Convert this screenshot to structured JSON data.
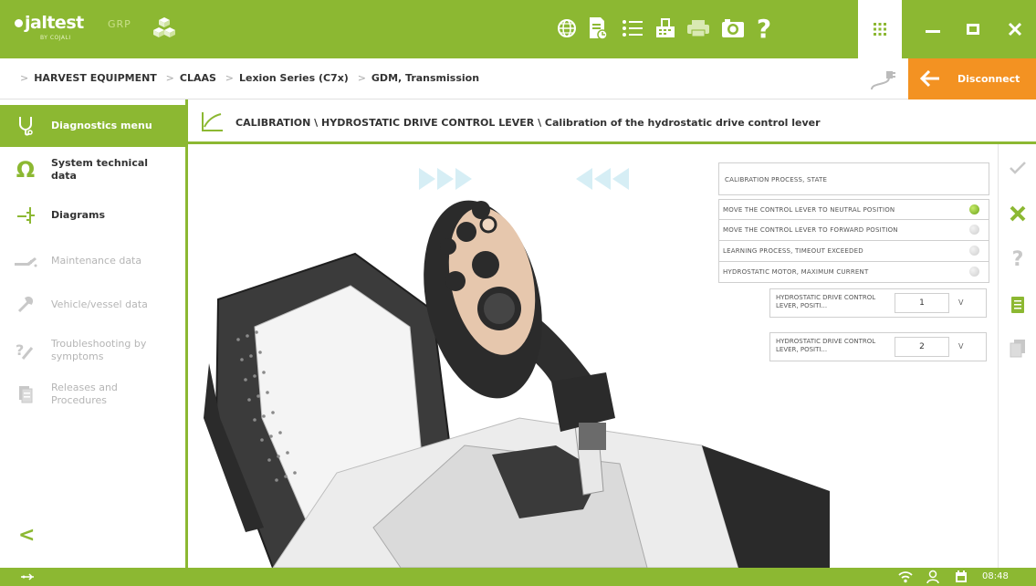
{
  "app": {
    "logo_text": "jaltest",
    "logo_sub": "BY COJALI",
    "logo_grp": "GRP"
  },
  "toolbar": {
    "icons": [
      "globe-icon",
      "report-icon",
      "list-icon",
      "inspection-icon",
      "print-icon",
      "camera-icon",
      "help-icon",
      "apps-grid-icon"
    ],
    "window": [
      "minimize-icon",
      "maximize-icon",
      "close-icon"
    ]
  },
  "breadcrumb": {
    "items": [
      "HARVEST EQUIPMENT",
      "CLAAS",
      "Lexion Series (C7x)",
      "GDM, Transmission"
    ]
  },
  "disconnect": {
    "label": "Disconnect"
  },
  "sidebar": {
    "items": [
      {
        "label": "Diagnostics menu",
        "state": "active"
      },
      {
        "label": "System technical data",
        "state": "enabled"
      },
      {
        "label": "Diagrams",
        "state": "enabled"
      },
      {
        "label": "Maintenance data",
        "state": "disabled"
      },
      {
        "label": "Vehicle/vessel data",
        "state": "disabled"
      },
      {
        "label": "Troubleshooting by symptoms",
        "state": "disabled"
      },
      {
        "label": "Releases and Procedures",
        "state": "disabled"
      }
    ]
  },
  "content": {
    "title": "CALIBRATION \\ HYDROSTATIC DRIVE CONTROL LEVER \\ Calibration of the hydrostatic drive control lever"
  },
  "calibration": {
    "header": "CALIBRATION PROCESS, STATE",
    "steps": [
      {
        "label": "MOVE THE CONTROL LEVER TO NEUTRAL POSITION",
        "status": "on"
      },
      {
        "label": "MOVE THE CONTROL LEVER TO FORWARD POSITION",
        "status": "off"
      },
      {
        "label": "LEARNING PROCESS, TIMEOUT EXCEEDED",
        "status": "off"
      },
      {
        "label": "HYDROSTATIC MOTOR, MAXIMUM CURRENT",
        "status": "off"
      }
    ],
    "values": [
      {
        "label": "HYDROSTATIC DRIVE CONTROL LEVER, POSITI...",
        "value": "1",
        "unit": "V"
      },
      {
        "label": "HYDROSTATIC DRIVE CONTROL LEVER, POSITI...",
        "value": "2",
        "unit": "V"
      }
    ]
  },
  "righttools": [
    "check-icon",
    "cancel-icon",
    "help-icon",
    "document-icon",
    "copy-icon"
  ],
  "statusbar": {
    "time": "08:48"
  },
  "colors": {
    "brand": "#8cb832",
    "accent": "#f39222"
  }
}
